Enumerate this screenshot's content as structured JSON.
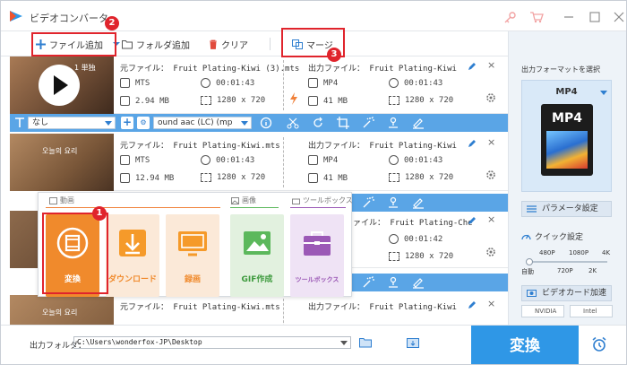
{
  "app": {
    "title": "ビデオコンバータ"
  },
  "toolbar": {
    "add_file": "ファイル追加",
    "add_folder": "フォルダ追加",
    "clear": "クリア",
    "merge": "マージ"
  },
  "rows": [
    {
      "thumb_text": "1 単独",
      "source": "元ファイル： Fruit Plating-Kiwi (3).mts",
      "src_format": "MTS",
      "src_duration": "00:01:43",
      "src_size": "2.94 MB",
      "src_resolution": "1280 x 720",
      "output": "出力ファイル： Fruit Plating-Kiwi",
      "out_format": "MP4",
      "out_duration": "00:01:43",
      "out_size": "41 MB",
      "out_resolution": "1280 x 720"
    },
    {
      "thumb_text": "오늘의 요리",
      "source": "元ファイル： Fruit Plating-Kiwi.mts",
      "src_format": "MTS",
      "src_duration": "00:01:43",
      "src_size": "12.94 MB",
      "src_resolution": "1280 x 720",
      "output": "出力ファイル： Fruit Plating-Kiwi",
      "out_format": "MP4",
      "out_duration": "00:01:43",
      "out_size": "41 MB",
      "out_resolution": "1280 x 720"
    },
    {
      "output": "ァイル： Fruit Plating-Che",
      "out_duration": "00:01:42",
      "out_resolution": "1280 x 720"
    },
    {
      "thumb_text": "오늘의 요리",
      "source": "元ファイル： Fruit Plating-Kiwi.mts",
      "output": "出力ファイル： Fruit Plating-Kiwi"
    }
  ],
  "bluebar": {
    "subtitle": "なし",
    "audio": "ound aac (LC) (mp"
  },
  "popup": {
    "tab_video": "動画",
    "tab_image": "画像",
    "tab_toolbox": "ツールボックス",
    "tiles": [
      "変換",
      "ダウンロード",
      "録画",
      "GIF作成",
      "ツールボックス"
    ]
  },
  "right_panel": {
    "output_format_label": "出力フォーマットを選択",
    "format": "MP4",
    "format_icon_text": "MP4",
    "params_button": "パラメータ設定",
    "quick_settings": "クイック設定",
    "quality_top": [
      "480P",
      "1080P",
      "4K"
    ],
    "quality_bottom": [
      "自動",
      "720P",
      "2K"
    ],
    "gpu_accel_button": "ビデオカード加速",
    "gpu_nvidia": "NVIDIA",
    "gpu_intel": "Intel"
  },
  "bottombar": {
    "output_folder_label": "出力フォルダ：",
    "output_path": "C:\\Users\\wonderfox-JP\\Desktop",
    "convert_button": "変換"
  },
  "annotations": {
    "badge1": "1",
    "badge2": "2",
    "badge3": "3"
  },
  "colors": {
    "accent_blue": "#2f97e6",
    "bar_blue": "#5aa5e6",
    "annotation_red": "#e0242c",
    "convert_orange": "#f08a2c",
    "download_orange": "#f59a2a",
    "record_orange": "#f59a2a",
    "gif_green": "#5cb85c",
    "toolbox_purple": "#9b59b6"
  }
}
